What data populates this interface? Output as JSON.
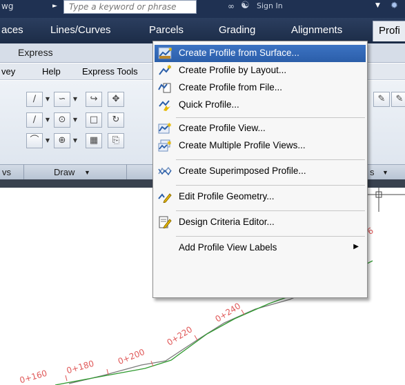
{
  "titlebar": {
    "file": "wg",
    "search_placeholder": "Type a keyword or phrase",
    "signin": "Sign In"
  },
  "tabs": [
    {
      "label": "aces"
    },
    {
      "label": "Lines/Curves"
    },
    {
      "label": "Parcels"
    },
    {
      "label": "Grading"
    },
    {
      "label": "Alignments"
    },
    {
      "label": "Profi"
    }
  ],
  "subtab": {
    "label": "Express"
  },
  "menubar": [
    {
      "label": "vey"
    },
    {
      "label": "Help"
    },
    {
      "label": "Express Tools"
    }
  ],
  "panels": {
    "left_label": "vs",
    "draw_label": "Draw",
    "right_label": "s"
  },
  "dropdown": {
    "items": [
      {
        "label": "Create Profile from Surface...",
        "icon": "profile-surface-icon",
        "highlighted": true
      },
      {
        "label": "Create Profile by Layout...",
        "icon": "profile-layout-icon"
      },
      {
        "label": "Create Profile from File...",
        "icon": "profile-file-icon"
      },
      {
        "label": "Quick Profile...",
        "icon": "quick-profile-icon"
      },
      {
        "label": "Create Profile View...",
        "icon": "profile-view-icon"
      },
      {
        "label": "Create Multiple Profile Views...",
        "icon": "multiple-profile-views-icon"
      },
      {
        "label": "Create Superimposed Profile...",
        "icon": "superimposed-profile-icon"
      },
      {
        "label": "Edit Profile Geometry...",
        "icon": "edit-geometry-icon"
      },
      {
        "label": "Design Criteria Editor...",
        "icon": "design-criteria-icon"
      },
      {
        "label": "Add Profile View Labels",
        "icon": "",
        "submenu": true
      }
    ]
  },
  "drawing": {
    "stations": [
      "0+160",
      "0+180",
      "0+200",
      "0+220",
      "0+240"
    ],
    "partial_label": "6"
  },
  "colors": {
    "highlight": "#3168b8",
    "station_label": "#e05858",
    "alignment_line": "#2e9a2e"
  }
}
